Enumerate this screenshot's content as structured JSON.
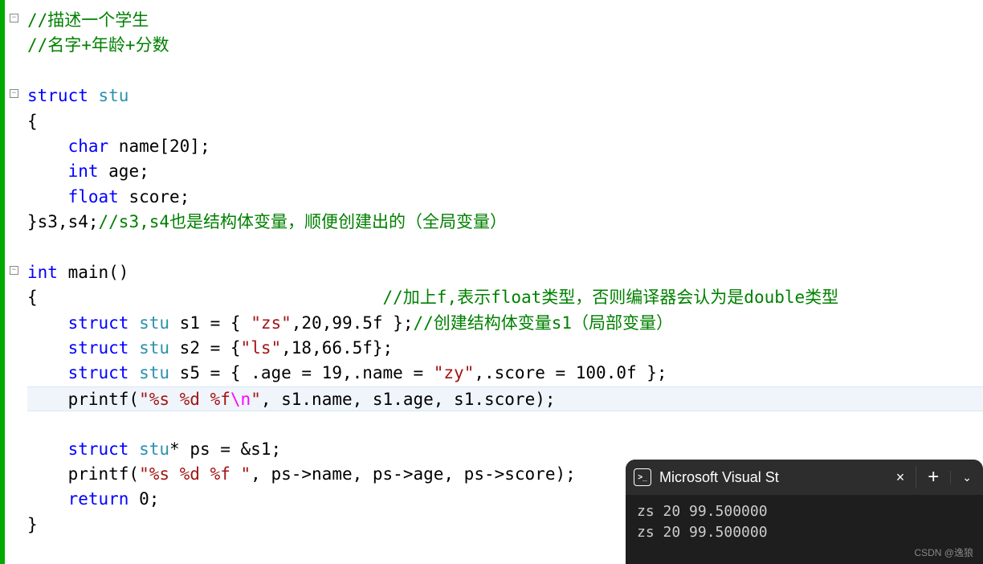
{
  "code": {
    "comment1": "//描述一个学生",
    "comment2": "//名字+年龄+分数",
    "kw_struct": "struct",
    "type_stu": "stu",
    "brace_open": "{",
    "brace_close": "}",
    "kw_char": "char",
    "name_decl_rest": " name[20];",
    "kw_int": "int",
    "age_decl_rest": " age;",
    "kw_float": "float",
    "score_decl_rest": " score;",
    "close_struct": "}s3,s4;",
    "comment3": "//s3,s4也是结构体变量，顺便创建出的（全局变量）",
    "main_rest": " main()",
    "brace_open2": "{                                  ",
    "comment4": "//加上f,表示float类型，否则编译器会认为是double类型",
    "s1_mid": " s1 = { ",
    "s1_str": "\"zs\"",
    "s1_rest": ",20,99.5f };",
    "comment5": "//创建结构体变量s1（局部变量）",
    "s2_mid": " s2 = {",
    "s2_str": "\"ls\"",
    "s2_rest": ",18,66.5f};",
    "s5_mid": " s5 = { .age = 19,.name = ",
    "s5_str": "\"zy\"",
    "s5_rest": ",.score = 100.0f };",
    "printf1_a": "printf(",
    "printf1_str1": "\"%s %d %f",
    "printf1_esc": "\\n",
    "printf1_str2": "\"",
    "printf1_rest": ", s1.name, s1.age, s1.score);",
    "ptr_mid": "* ps = &s1;",
    "printf2_str": "\"%s %d %f \"",
    "printf2_rest": ", ps->name, ps->age, ps->score);",
    "kw_return": "return",
    "return_rest": " 0;",
    "brace_close2": "}"
  },
  "terminal": {
    "title": "Microsoft Visual St",
    "line1": "zs 20 99.500000",
    "line2": "zs 20 99.500000"
  },
  "watermark": "CSDN @逸狼",
  "fold_symbol": "−"
}
